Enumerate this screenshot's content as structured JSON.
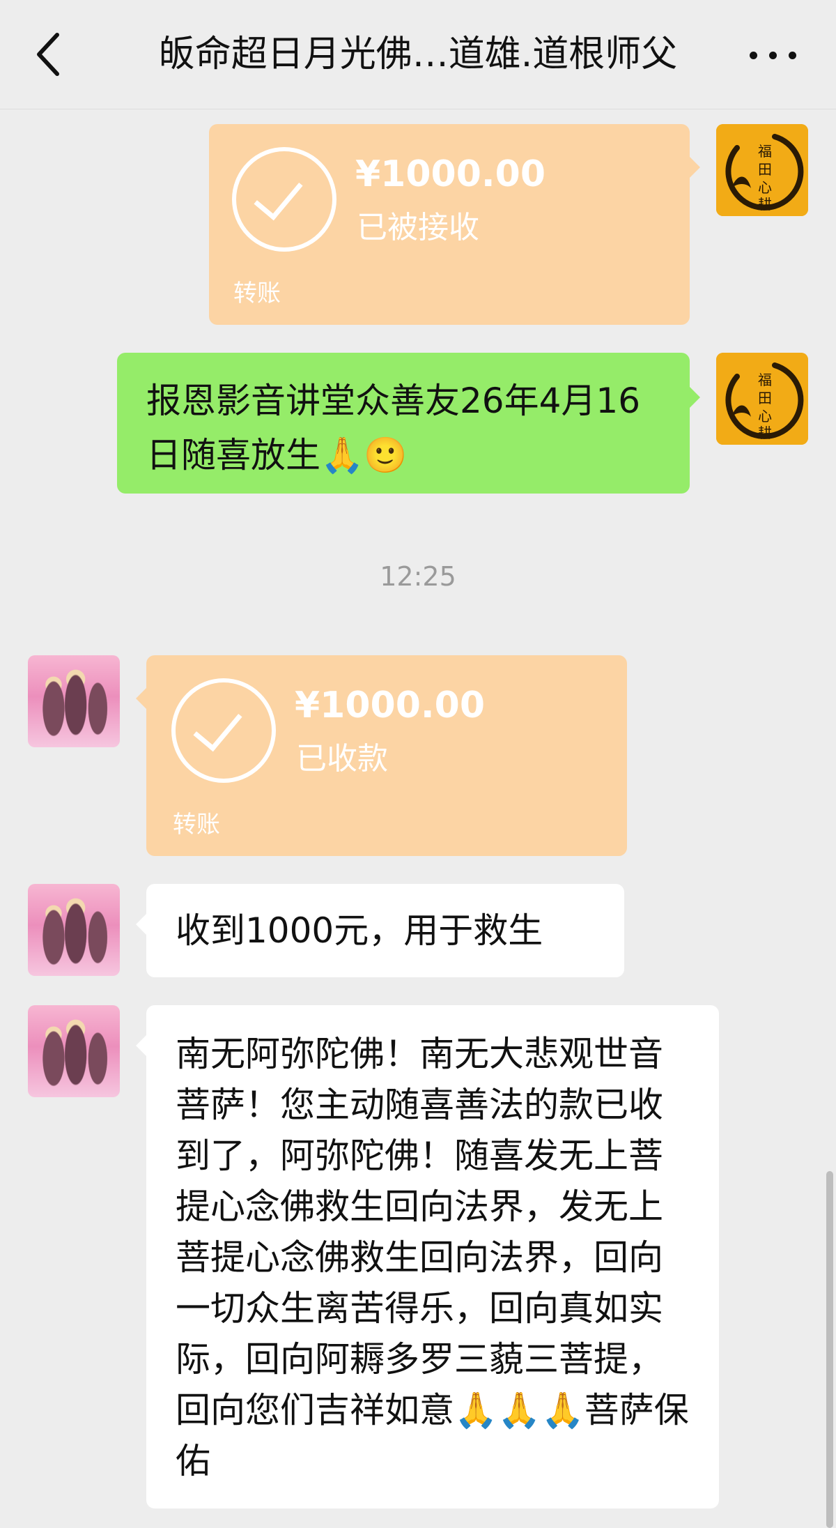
{
  "header": {
    "title": "皈命超日月光佛…道雄.道根师父",
    "back_icon": "chevron-left-icon",
    "more_icon": "more-icon"
  },
  "messages": [
    {
      "type": "transfer",
      "amount": "¥1000.00",
      "status": "已被接收",
      "kind": "转账"
    },
    {
      "type": "text",
      "text": "报恩影音讲堂众善友26年4月16日随喜放生🙏🙂"
    },
    {
      "type": "time",
      "text": "12:25"
    },
    {
      "type": "transfer",
      "amount": "¥1000.00",
      "status": "已收款",
      "kind": "转账"
    },
    {
      "type": "text",
      "text": "收到1000元，用于救生"
    },
    {
      "type": "text",
      "text": "南无阿弥陀佛！南无大悲观世音菩萨！您主动随喜善法的款已收到了，阿弥陀佛！随喜发无上菩提心念佛救生回向法界，发无上菩提心念佛救生回向法界，回向一切众生离苦得乐，回向真如实际，回向阿耨多罗三藐三菩提，回向您们吉祥如意🙏🙏🙏菩萨保佑"
    }
  ],
  "avatars": {
    "me_text": [
      "福",
      "田",
      "心",
      "耕"
    ]
  },
  "colors": {
    "background": "#ededed",
    "transfer_bubble": "#fcd4a4",
    "sent_bubble": "#95ec69",
    "received_bubble": "#ffffff"
  }
}
